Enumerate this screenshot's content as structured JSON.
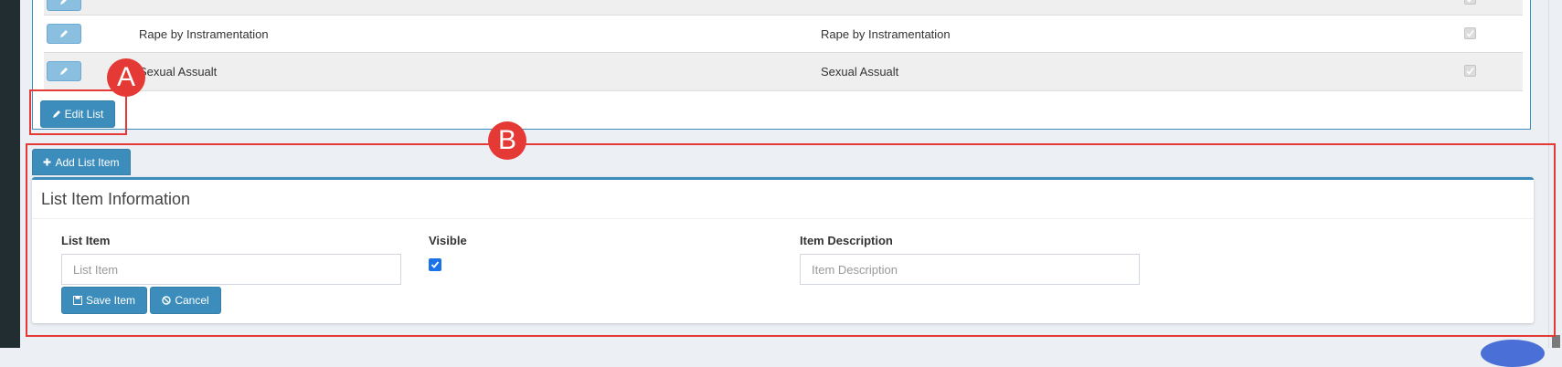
{
  "table": {
    "rows": [
      {
        "name": "",
        "description": ""
      },
      {
        "name": "Rape by Instramentation",
        "description": "Rape by Instramentation"
      },
      {
        "name": "Sexual Assualt",
        "description": "Sexual Assualt"
      }
    ]
  },
  "edit_list_label": "Edit List",
  "add_list_item_label": "Add List Item",
  "form": {
    "title": "List Item Information",
    "list_item_label": "List Item",
    "list_item_placeholder": "List Item",
    "visible_label": "Visible",
    "item_description_label": "Item Description",
    "item_description_placeholder": "Item Description",
    "save_label": "Save Item",
    "cancel_label": "Cancel"
  },
  "annotations": {
    "a": "A",
    "b": "B"
  },
  "colors": {
    "primary": "#3c8dbc",
    "annotation": "#e53935",
    "checkbox": "#1a73e8"
  }
}
